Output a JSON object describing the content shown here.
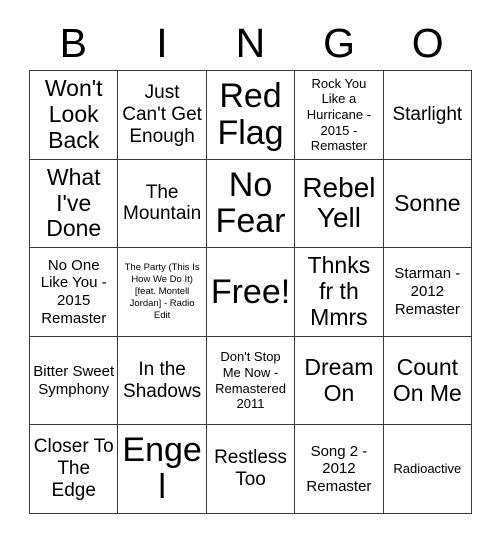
{
  "card": {
    "title": "Bingo Card",
    "columns": [
      "B",
      "I",
      "N",
      "G",
      "O"
    ],
    "grid_color": "#3a3a3a",
    "text_color": "#000000",
    "background_color": "#ffffff"
  },
  "rows": [
    {
      "cells": [
        {
          "text": "Won't Look Back",
          "size": "lg"
        },
        {
          "text": "Just Can't Get Enough",
          "size": "md"
        },
        {
          "text": "Red Flag",
          "size": "xxl"
        },
        {
          "text": "Rock You Like a Hurricane - 2015 - Remaster",
          "size": "xs"
        },
        {
          "text": "Starlight",
          "size": "md"
        }
      ]
    },
    {
      "cells": [
        {
          "text": "What I've Done",
          "size": "lg"
        },
        {
          "text": "The Mountain",
          "size": "md"
        },
        {
          "text": "No Fear",
          "size": "xxl"
        },
        {
          "text": "Rebel Yell",
          "size": "xl"
        },
        {
          "text": "Sonne",
          "size": "lg"
        }
      ]
    },
    {
      "cells": [
        {
          "text": "No One Like You - 2015 Remaster",
          "size": "sm"
        },
        {
          "text": "The Party (This Is How We Do It) [feat. Montell Jordan] - Radio Edit",
          "size": "xxs"
        },
        {
          "text": "Free!",
          "size": "xxl"
        },
        {
          "text": "Thnks fr th Mmrs",
          "size": "lg"
        },
        {
          "text": "Starman - 2012 Remaster",
          "size": "sm"
        }
      ]
    },
    {
      "cells": [
        {
          "text": "Bitter Sweet Symphony",
          "size": "sm"
        },
        {
          "text": "In the Shadows",
          "size": "md"
        },
        {
          "text": "Don't Stop Me Now - Remastered 2011",
          "size": "xs"
        },
        {
          "text": "Dream On",
          "size": "lg"
        },
        {
          "text": "Count On Me",
          "size": "lg"
        }
      ]
    },
    {
      "cells": [
        {
          "text": "Closer To The Edge",
          "size": "md"
        },
        {
          "text": "Engel",
          "size": "xxl"
        },
        {
          "text": "Restless Too",
          "size": "md"
        },
        {
          "text": "Song 2 - 2012 Remaster",
          "size": "sm"
        },
        {
          "text": "Radioactive",
          "size": "xs"
        }
      ]
    }
  ]
}
